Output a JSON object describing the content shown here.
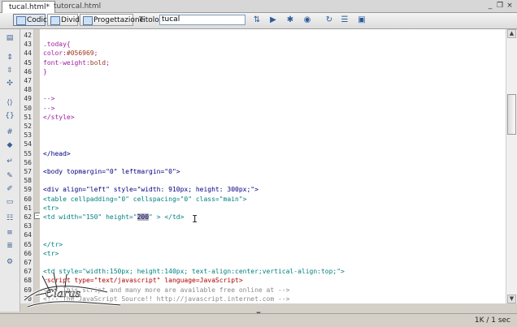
{
  "tabs": [
    {
      "label": "tucal.html*",
      "active": true
    },
    {
      "label": "tutorcal.html",
      "active": false
    }
  ],
  "window_controls": [
    "_",
    "❐",
    "×"
  ],
  "toolbar": {
    "view_buttons": [
      {
        "label": "Codice",
        "icon": "code-view-icon",
        "pressed": true
      },
      {
        "label": "Dividi",
        "icon": "split-view-icon",
        "pressed": false
      },
      {
        "label": "Progettazione",
        "icon": "design-view-icon",
        "pressed": false
      }
    ],
    "title_label": "Titolo:",
    "title_value": "tucal",
    "tool_icons": [
      "file-management-icon",
      "preview-icon",
      "debug-icon",
      "check-page-icon",
      "refresh-icon",
      "view-options-icon",
      "visual-aids-icon"
    ]
  },
  "gutter_icons": [
    "open-documents-icon",
    "collapse-tag-icon",
    "collapse-selection-icon",
    "expand-all-icon",
    "select-parent-icon",
    "balance-braces-icon",
    "line-numbers-icon",
    "highlight-invalid-icon",
    "word-wrap-icon",
    "apply-comment-icon",
    "remove-comment-icon",
    "wrap-tag-icon",
    "recent-snippets-icon",
    "indent-icon",
    "outdent-icon",
    "format-source-icon"
  ],
  "code_lines": [
    {
      "num": "42",
      "segs": [
        {
          "t": "",
          "c": ""
        }
      ]
    },
    {
      "num": "43",
      "segs": [
        {
          "t": ".today{",
          "c": "purple"
        }
      ]
    },
    {
      "num": "44",
      "segs": [
        {
          "t": "color:",
          "c": "purple"
        },
        {
          "t": "#056969",
          "c": "brown"
        },
        {
          "t": ";",
          "c": "purple"
        }
      ]
    },
    {
      "num": "45",
      "segs": [
        {
          "t": "font-weight:",
          "c": "purple"
        },
        {
          "t": "bold",
          "c": "brown"
        },
        {
          "t": ";",
          "c": "purple"
        }
      ]
    },
    {
      "num": "46",
      "segs": [
        {
          "t": "}",
          "c": "purple"
        }
      ]
    },
    {
      "num": "47",
      "segs": [
        {
          "t": "",
          "c": ""
        }
      ]
    },
    {
      "num": "48",
      "segs": [
        {
          "t": "",
          "c": ""
        }
      ]
    },
    {
      "num": "49",
      "segs": [
        {
          "t": "-->",
          "c": "purple"
        }
      ]
    },
    {
      "num": "50",
      "segs": [
        {
          "t": "-->",
          "c": "purple"
        }
      ]
    },
    {
      "num": "51",
      "segs": [
        {
          "t": "</style>",
          "c": "purple"
        }
      ]
    },
    {
      "num": "52",
      "segs": [
        {
          "t": "",
          "c": ""
        }
      ]
    },
    {
      "num": "53",
      "segs": [
        {
          "t": "",
          "c": ""
        }
      ]
    },
    {
      "num": "54",
      "segs": [
        {
          "t": "",
          "c": ""
        }
      ]
    },
    {
      "num": "55",
      "segs": [
        {
          "t": "</head>",
          "c": "navy"
        }
      ]
    },
    {
      "num": "56",
      "segs": [
        {
          "t": "",
          "c": ""
        }
      ]
    },
    {
      "num": "57",
      "segs": [
        {
          "t": "<body topmargin=\"0\" leftmargin=\"0\">",
          "c": "navy"
        }
      ]
    },
    {
      "num": "58",
      "segs": [
        {
          "t": "",
          "c": ""
        }
      ]
    },
    {
      "num": "59",
      "segs": [
        {
          "t": "<div align=\"left\" style=\"width: 910px; height: 300px;\">",
          "c": "navy"
        }
      ]
    },
    {
      "num": "60",
      "segs": [
        {
          "t": "<table cellpadding=\"0\" cellspacing=\"0\" class=\"main\">",
          "c": "teal"
        }
      ]
    },
    {
      "num": "61",
      "segs": [
        {
          "t": "<tr>",
          "c": "teal"
        }
      ]
    },
    {
      "num": "62",
      "segs": [
        {
          "t": "<td width=\"150\" height=\"",
          "c": "teal"
        },
        {
          "t": "200",
          "c": "sel"
        },
        {
          "t": "\" > </td>",
          "c": "teal"
        }
      ]
    },
    {
      "num": "63",
      "segs": [
        {
          "t": "",
          "c": ""
        }
      ]
    },
    {
      "num": "64",
      "segs": [
        {
          "t": "",
          "c": ""
        }
      ]
    },
    {
      "num": "65",
      "segs": [
        {
          "t": "</tr>",
          "c": "teal"
        }
      ]
    },
    {
      "num": "66",
      "segs": [
        {
          "t": "<tr>",
          "c": "teal"
        }
      ]
    },
    {
      "num": "67",
      "segs": [
        {
          "t": "",
          "c": ""
        }
      ]
    },
    {
      "num": "67",
      "segs": [
        {
          "t": "<td style=\"width:150px; height:140px; text-align:center;vertical-align:top;\">",
          "c": "teal"
        }
      ]
    },
    {
      "num": "68",
      "segs": [
        {
          "t": "<script type=\"text/javascript\" language=JavaScript>",
          "c": "red"
        }
      ]
    },
    {
      "num": "69",
      "segs": [
        {
          "t": "<!-- This script and many more are available free online at -->",
          "c": "gray"
        }
      ]
    },
    {
      "num": "70",
      "segs": [
        {
          "t": "<!-- The JavaScript Source!! http://javascript.internet.com -->",
          "c": "gray"
        }
      ]
    },
    {
      "num": "71",
      "segs": [
        {
          "t": "",
          "c": ""
        }
      ]
    }
  ],
  "fold_marker_line": "62",
  "status_text": "1K / 1 sec",
  "watermark_text": "Clarus"
}
